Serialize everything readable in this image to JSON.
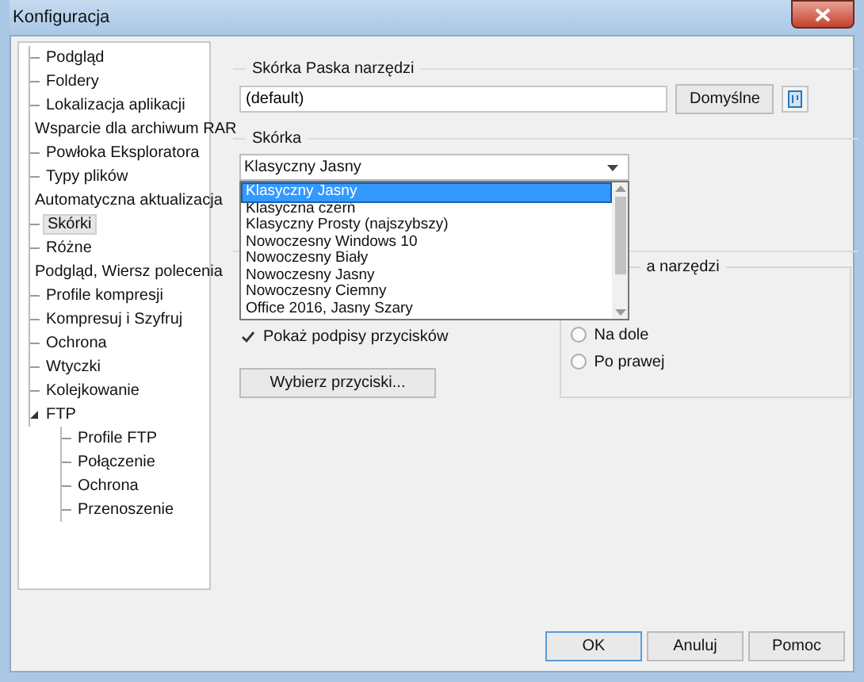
{
  "window": {
    "title": "Konfiguracja"
  },
  "tree": [
    {
      "label": "Podgląd",
      "selected": false
    },
    {
      "label": "Foldery",
      "selected": false
    },
    {
      "label": "Lokalizacja aplikacji",
      "selected": false
    },
    {
      "label": "Wsparcie dla archiwum RAR",
      "selected": false
    },
    {
      "label": "Powłoka Eksploratora",
      "selected": false
    },
    {
      "label": "Typy plików",
      "selected": false
    },
    {
      "label": "Automatyczna aktualizacja",
      "selected": false
    },
    {
      "label": "Skórki",
      "selected": true
    },
    {
      "label": "Różne",
      "selected": false
    },
    {
      "label": "Podgląd, Wiersz polecenia",
      "selected": false
    },
    {
      "label": "Profile kompresji",
      "selected": false
    },
    {
      "label": "Kompresuj i Szyfruj",
      "selected": false
    },
    {
      "label": "Ochrona",
      "selected": false
    },
    {
      "label": "Wtyczki",
      "selected": false
    },
    {
      "label": "Kolejkowanie",
      "selected": false
    },
    {
      "label": "FTP",
      "selected": false,
      "expanded": true,
      "children": [
        {
          "label": "Profile FTP",
          "selected": false
        },
        {
          "label": "Połączenie",
          "selected": false
        },
        {
          "label": "Ochrona",
          "selected": false
        },
        {
          "label": "Przenoszenie",
          "selected": false
        }
      ]
    }
  ],
  "toolbar_skin": {
    "legend": "Skórka Paska narzędzi",
    "value": "(default)",
    "default_button": "Domyślne"
  },
  "skin": {
    "legend": "Skórka",
    "value": "Klasyczny Jasny",
    "options": [
      {
        "label": "Klasyczny Jasny",
        "selected": true
      },
      {
        "label": "Klasyczna czerń",
        "selected": false
      },
      {
        "label": "Klasyczny Prosty (najszybszy)",
        "selected": false
      },
      {
        "label": "Nowoczesny Windows 10",
        "selected": false
      },
      {
        "label": "Nowoczesny Biały",
        "selected": false
      },
      {
        "label": "Nowoczesny Jasny",
        "selected": false
      },
      {
        "label": "Nowoczesny Ciemny",
        "selected": false
      },
      {
        "label": "Office 2016, Jasny Szary",
        "selected": false
      }
    ]
  },
  "buttons_section": {
    "checkbox": {
      "label": "Pokaż podpisy przycisków",
      "checked": true
    },
    "choose_button": "Wybierz przyciski...",
    "position": {
      "legend": "a narzędzi",
      "options": [
        {
          "label": "Na dole",
          "selected": false
        },
        {
          "label": "Po prawej",
          "selected": false
        }
      ]
    }
  },
  "footer": [
    "OK",
    "Anuluj",
    "Pomoc"
  ]
}
